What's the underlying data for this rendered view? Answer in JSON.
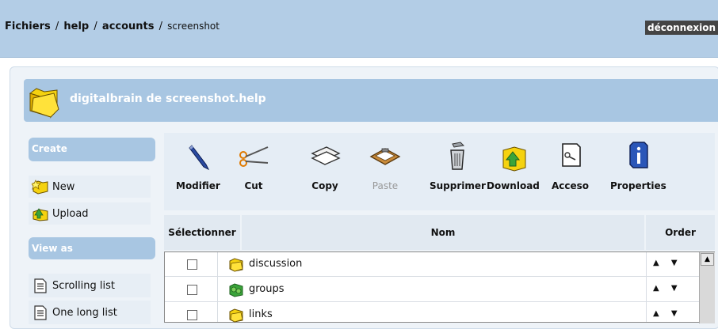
{
  "breadcrumb": {
    "parts": [
      "Fichiers",
      "help",
      "accounts"
    ],
    "current": "screenshot",
    "separator": "/"
  },
  "logout_label": "déconnexion",
  "title": "digitalbrain de screenshot.help",
  "sidebar": {
    "create": {
      "heading": "Create",
      "items": [
        {
          "label": "New",
          "icon": "new-folder-icon"
        },
        {
          "label": "Upload",
          "icon": "upload-icon"
        }
      ]
    },
    "view_as": {
      "heading": "View as",
      "items": [
        {
          "label": "Scrolling list",
          "icon": "list-icon"
        },
        {
          "label": "One long list",
          "icon": "list-icon"
        }
      ]
    }
  },
  "toolbar": [
    {
      "label": "Modifier",
      "icon": "pencil-icon",
      "enabled": true
    },
    {
      "label": "Cut",
      "icon": "scissors-icon",
      "enabled": true
    },
    {
      "label": "Copy",
      "icon": "copy-icon",
      "enabled": true
    },
    {
      "label": "Paste",
      "icon": "clipboard-icon",
      "enabled": false
    },
    {
      "label": "Supprimer",
      "icon": "trash-icon",
      "enabled": true
    },
    {
      "label": "Download",
      "icon": "download-icon",
      "enabled": true
    },
    {
      "label": "Acceso",
      "icon": "key-icon",
      "enabled": true
    },
    {
      "label": "Properties",
      "icon": "info-icon",
      "enabled": true
    }
  ],
  "table": {
    "columns": [
      "Sélectionner",
      "Nom",
      "Order"
    ],
    "rows": [
      {
        "name": "discussion",
        "icon": "folder-icon"
      },
      {
        "name": "groups",
        "icon": "group-icon"
      },
      {
        "name": "links",
        "icon": "folder-icon"
      }
    ],
    "order_arrows": "▲ ▼"
  },
  "colors": {
    "header_bg": "#b3cde6",
    "title_bg": "#a8c6e2",
    "folder_yellow": "#f5d20f"
  }
}
